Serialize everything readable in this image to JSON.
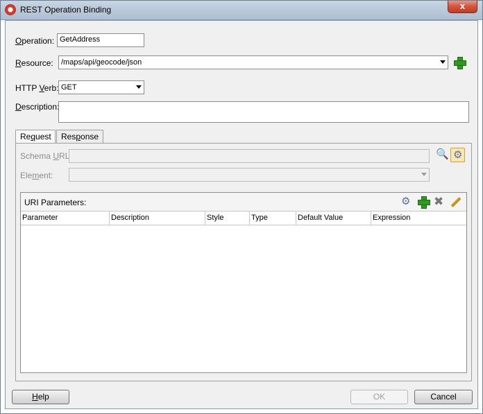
{
  "window": {
    "title": "REST Operation Binding",
    "close_glyph": "x"
  },
  "form": {
    "operation": {
      "label_pre": "",
      "label_u": "O",
      "label_post": "peration:",
      "value": "GetAddress"
    },
    "resource": {
      "label_pre": "",
      "label_u": "R",
      "label_post": "esource:",
      "value": "/maps/api/geocode/json"
    },
    "http_verb": {
      "label_pre": "HTTP ",
      "label_u": "V",
      "label_post": "erb:",
      "value": "GET"
    },
    "description": {
      "label_pre": "",
      "label_u": "D",
      "label_post": "escription:",
      "value": ""
    }
  },
  "tabs": [
    {
      "label_pre": "Re",
      "label_u": "q",
      "label_post": "uest",
      "active": true
    },
    {
      "label_pre": "Res",
      "label_u": "p",
      "label_post": "onse",
      "active": false
    }
  ],
  "request": {
    "schema_url": {
      "label_pre": "Schema ",
      "label_u": "U",
      "label_post": "RL:",
      "value": ""
    },
    "element": {
      "label_pre": "Ele",
      "label_u": "m",
      "label_post": "ent:",
      "value": ""
    },
    "uri_params": {
      "title": "URI Parameters:",
      "columns": [
        "Parameter",
        "Description",
        "Style",
        "Type",
        "Default Value",
        "Expression"
      ],
      "rows": []
    }
  },
  "buttons": {
    "help": {
      "label_u": "H",
      "label_post": "elp"
    },
    "ok": "OK",
    "cancel": "Cancel"
  },
  "colors": {
    "add_green": "#2e9b1f",
    "selected_orange": "#e39b2c",
    "close_red": "#c43a22"
  }
}
